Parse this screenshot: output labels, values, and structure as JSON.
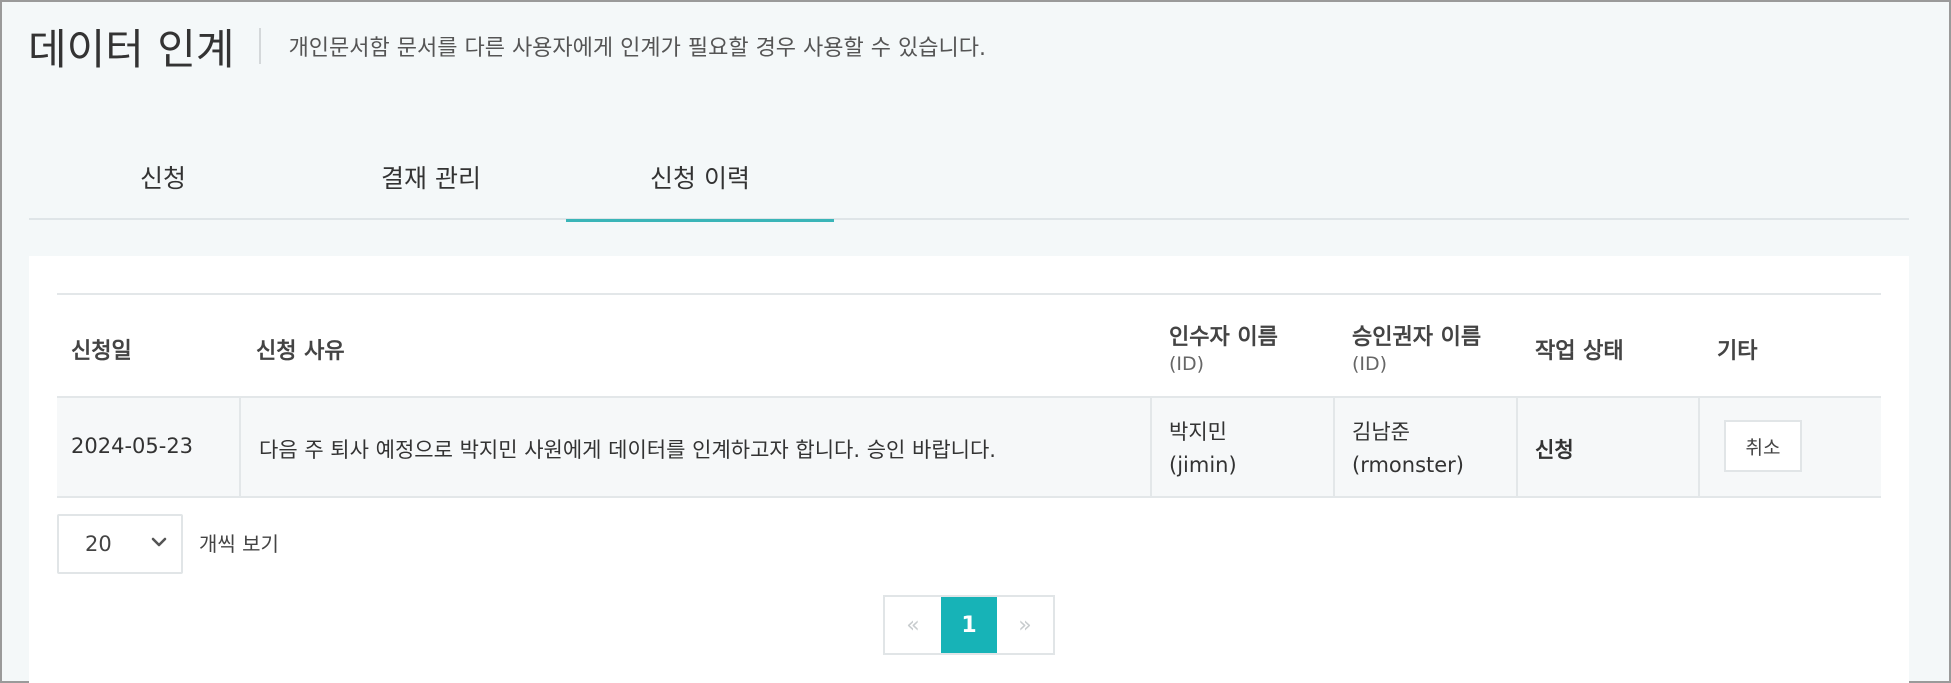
{
  "header": {
    "title": "데이터 인계",
    "description": "개인문서함 문서를 다른 사용자에게 인계가 필요할 경우 사용할 수 있습니다."
  },
  "tabs": [
    {
      "label": "신청",
      "active": false
    },
    {
      "label": "결재 관리",
      "active": false
    },
    {
      "label": "신청 이력",
      "active": true
    }
  ],
  "table": {
    "columns": {
      "date": "신청일",
      "reason": "신청 사유",
      "recipient": "인수자 이름",
      "recipient_sub": "(ID)",
      "approver": "승인권자 이름",
      "approver_sub": "(ID)",
      "status": "작업 상태",
      "etc": "기타"
    },
    "rows": [
      {
        "date": "2024-05-23",
        "reason": "다음 주 퇴사 예정으로 박지민 사원에게 데이터를 인계하고자 합니다. 승인 바랍니다.",
        "recipient_name": "박지민",
        "recipient_id": "(jimin)",
        "approver_name": "김남준",
        "approver_id": "(rmonster)",
        "status": "신청",
        "action_label": "취소"
      }
    ]
  },
  "pagination": {
    "page_size": "20",
    "page_size_label": "개씩 보기",
    "prev": "«",
    "current": "1",
    "next": "»"
  },
  "colors": {
    "accent": "#17b3b7",
    "tab_underline": "#3ab5b8",
    "background": "#f4f8f9"
  }
}
